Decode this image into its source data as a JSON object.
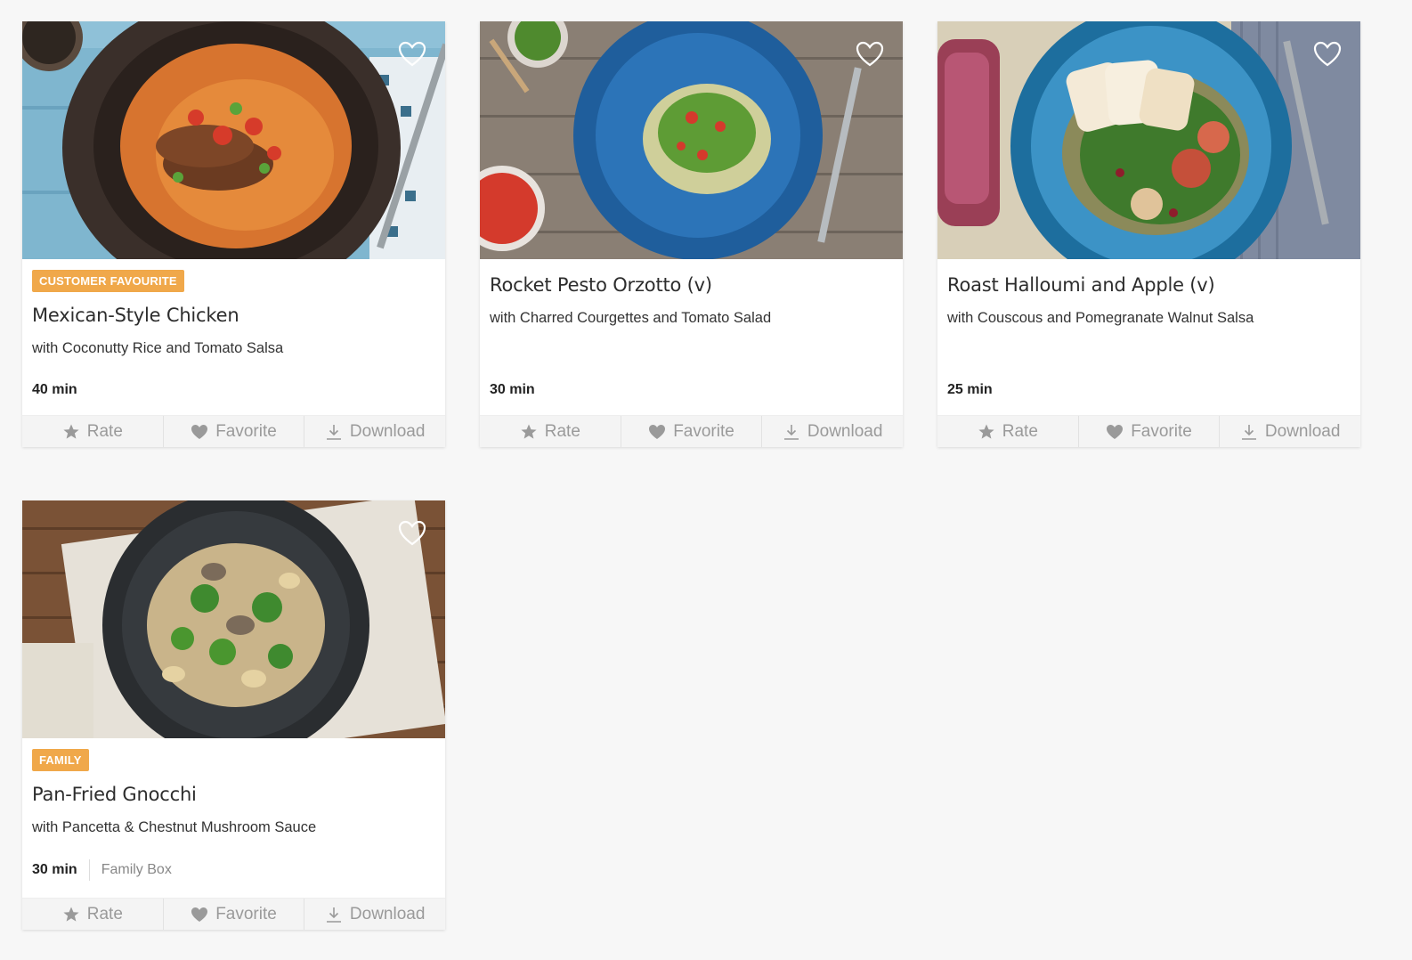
{
  "recipes": [
    {
      "badge": "CUSTOMER FAVOURITE",
      "title": "Mexican-Style Chicken",
      "subtitle": "with Coconutty Rice and Tomato Salsa",
      "time": "40 min",
      "box": ""
    },
    {
      "badge": "",
      "title": "Rocket Pesto Orzotto (v)",
      "subtitle": "with Charred Courgettes and Tomato Salad",
      "time": "30 min",
      "box": ""
    },
    {
      "badge": "",
      "title": "Roast Halloumi and Apple (v)",
      "subtitle": "with Couscous and Pomegranate Walnut Salsa",
      "time": "25 min",
      "box": ""
    },
    {
      "badge": "FAMILY",
      "title": "Pan-Fried Gnocchi",
      "subtitle": "with Pancetta & Chestnut Mushroom Sauce",
      "time": "30 min",
      "box": "Family Box"
    }
  ],
  "actions": {
    "rate": "Rate",
    "favorite": "Favorite",
    "download": "Download"
  },
  "icons": {
    "favorite_toggle": "heart-outline-icon",
    "rate": "star-icon",
    "favorite": "heart-icon",
    "download": "download-icon"
  },
  "colors": {
    "badge": "#f0a84a",
    "action_text": "#9a9a9a",
    "page_bg": "#f7f7f7"
  }
}
